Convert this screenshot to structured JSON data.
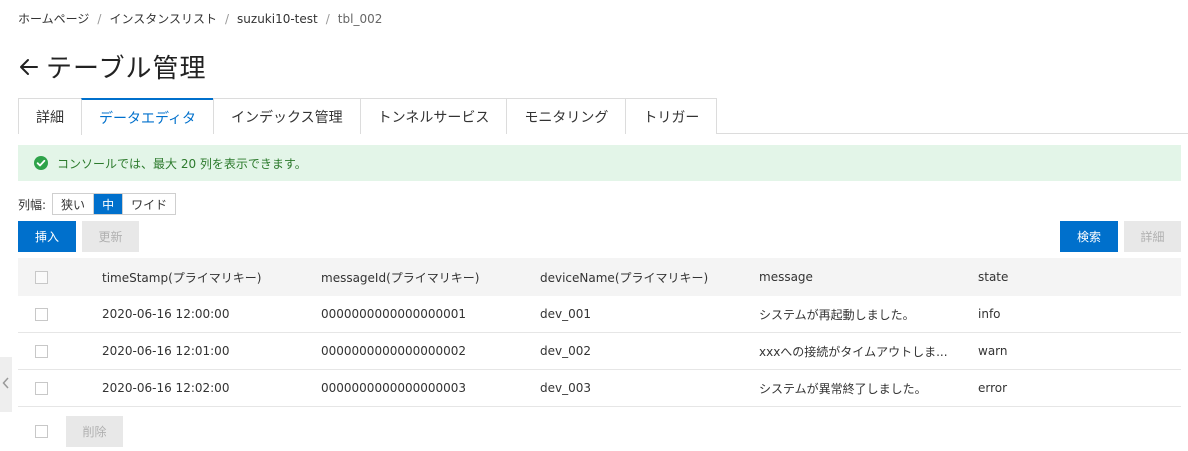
{
  "breadcrumb": {
    "items": [
      "ホームページ",
      "インスタンスリスト",
      "suzuki10-test",
      "tbl_002"
    ],
    "separator": "/"
  },
  "header": {
    "title": "テーブル管理",
    "back_icon": "arrow-left-icon"
  },
  "tabs": [
    {
      "label": "詳細",
      "active": false
    },
    {
      "label": "データエディタ",
      "active": true
    },
    {
      "label": "インデックス管理",
      "active": false
    },
    {
      "label": "トンネルサービス",
      "active": false
    },
    {
      "label": "モニタリング",
      "active": false
    },
    {
      "label": "トリガー",
      "active": false
    }
  ],
  "alert": {
    "text": "コンソールでは、最大 20 列を表示できます。",
    "icon": "check-circle-icon"
  },
  "column_width": {
    "label": "列幅:",
    "options": [
      "狭い",
      "中",
      "ワイド"
    ],
    "selected": "中"
  },
  "toolbar": {
    "insert_label": "挿入",
    "update_label": "更新",
    "search_label": "検索",
    "detail_label": "詳細"
  },
  "table": {
    "columns": [
      "timeStamp(プライマリキー)",
      "messageId(プライマリキー)",
      "deviceName(プライマリキー)",
      "message",
      "state"
    ],
    "rows": [
      [
        "2020-06-16 12:00:00",
        "0000000000000000001",
        "dev_001",
        "システムが再起動しました。",
        "info"
      ],
      [
        "2020-06-16 12:01:00",
        "0000000000000000002",
        "dev_002",
        "xxxへの接続がタイムアウトしま...",
        "warn"
      ],
      [
        "2020-06-16 12:02:00",
        "0000000000000000003",
        "dev_003",
        "システムが異常終了しました。",
        "error"
      ]
    ]
  },
  "footer": {
    "delete_label": "削除"
  },
  "colors": {
    "primary": "#0070cc",
    "success_bg": "#e3f5e8",
    "success_text": "#2c7a2c",
    "disabled_bg": "#e8e8e8"
  }
}
